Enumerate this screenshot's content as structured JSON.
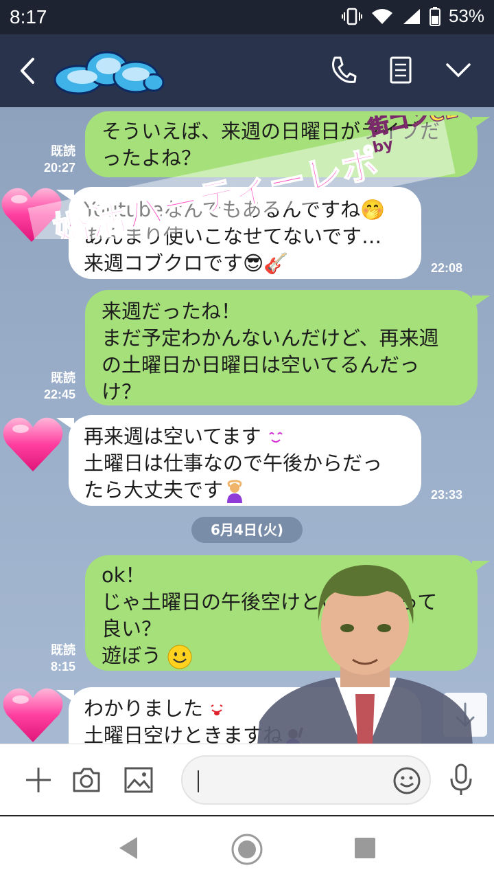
{
  "status": {
    "time": "8:17",
    "battery": "53%"
  },
  "header": {
    "icons": [
      "back-icon",
      "cloud-logo",
      "phone-icon",
      "note-icon",
      "chevron-down-icon"
    ]
  },
  "watermark": {
    "title": "婚活パーティーレポ",
    "subtitle": "by",
    "brand": "街コンCEO"
  },
  "messages": [
    {
      "dir": "out",
      "read": "既読",
      "time": "20:27",
      "lines": [
        "そういえば、来週の日曜日がライブだ",
        "ったよね？"
      ]
    },
    {
      "dir": "in",
      "time": "22:08",
      "lines": [
        "Youtubeなんでもあるんですね🤭",
        "あんまり使いこなせてないです…",
        "来週コブクロです😎🎸"
      ]
    },
    {
      "dir": "out",
      "read": "既読",
      "time": "22:45",
      "lines": [
        "来週だったね！",
        "まだ予定わかんないんだけど、再来週",
        "の土曜日か日曜日は空いてるんだっ",
        "け？"
      ]
    },
    {
      "dir": "in",
      "time": "23:33",
      "lines": [
        "再来週は空いてます",
        "土曜日は仕事なので午後からだっ",
        "たら大丈夫です"
      ]
    },
    {
      "dir": "out",
      "read": "既読",
      "time": "8:15",
      "lines": [
        "ok！",
        "じゃ土曜日の午後空けといてもらって",
        "良い？",
        "遊ぼう"
      ]
    },
    {
      "dir": "in",
      "lines": [
        "わかりました",
        "土曜日空けときますね"
      ]
    }
  ],
  "date_divider": "6月4日(火)",
  "colors": {
    "outgoing": "#a5e07a",
    "incoming": "#ffffff",
    "header": "#29344c",
    "chat_bg": "#8ea2be"
  }
}
